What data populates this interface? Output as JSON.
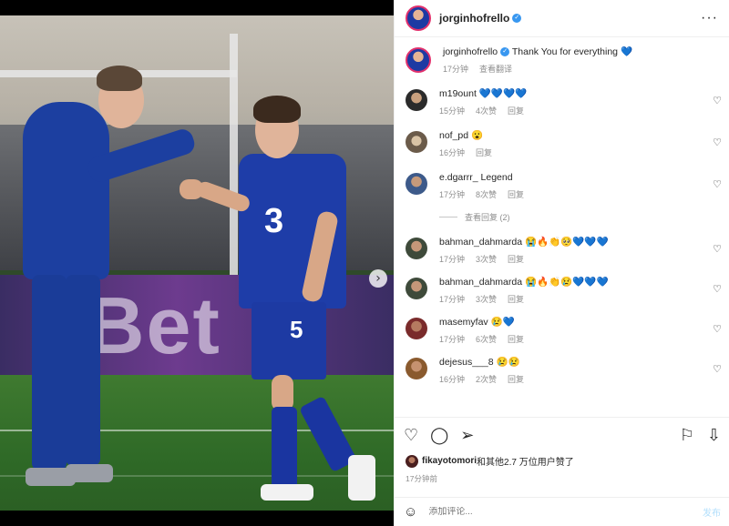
{
  "post": {
    "username": "jorginhofrello",
    "caption": "Thank You for everything",
    "caption_emoji": "💙",
    "caption_time": "17分钟",
    "translate": "查看翻译",
    "more": "···"
  },
  "photo": {
    "board_text": "Bet",
    "shirt_number": "5",
    "sponsor": "3"
  },
  "comments": [
    {
      "user": "m19ount",
      "text": "💙💙💙💙",
      "time": "15分钟",
      "likes": "4次赞",
      "reply": "回复"
    },
    {
      "user": "nof_pd",
      "text": "😮",
      "time": "16分钟",
      "likes": "",
      "reply": "回复"
    },
    {
      "user": "e.dgarrr_",
      "text": "Legend",
      "time": "17分钟",
      "likes": "8次赞",
      "reply": "回复"
    },
    {
      "user": "bahman_dahmarda",
      "text": "😭🔥👏🥺💙💙💙",
      "time": "17分钟",
      "likes": "3次赞",
      "reply": "回复"
    },
    {
      "user": "bahman_dahmarda",
      "text": "😭🔥👏😢💙💙💙",
      "time": "17分钟",
      "likes": "3次赞",
      "reply": "回复"
    },
    {
      "user": "masemyfav",
      "text": "😢💙",
      "time": "17分钟",
      "likes": "6次赞",
      "reply": "回复"
    },
    {
      "user": "dejesus___8",
      "text": "😢😢",
      "time": "16分钟",
      "likes": "2次赞",
      "reply": "回复"
    }
  ],
  "view_replies": "查看回复 (2)",
  "likes_text_user": "fikayotomori",
  "likes_text_rest": "和其他2.7 万位用户赞了",
  "post_time": "17分钟前",
  "add_comment_placeholder": "添加评论...",
  "post_button": "发布"
}
